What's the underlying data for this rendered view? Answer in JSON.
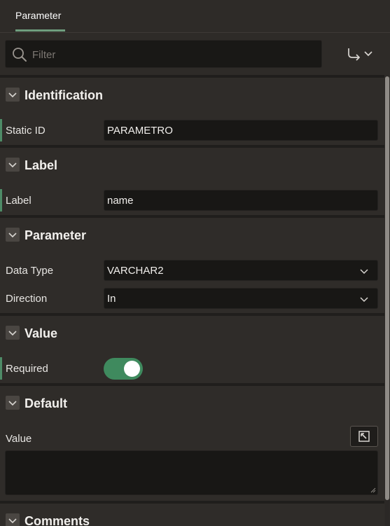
{
  "tabs": [
    {
      "label": "Parameter"
    }
  ],
  "toolbar": {
    "filter_placeholder": "Filter",
    "search_icon": "search-icon",
    "goto_icon": "go-to-group-icon"
  },
  "groups": {
    "identification": {
      "title": "Identification",
      "static_id_label": "Static ID",
      "static_id_value": "PARAMETRO"
    },
    "label": {
      "title": "Label",
      "label_label": "Label",
      "label_value": "name"
    },
    "parameter": {
      "title": "Parameter",
      "data_type_label": "Data Type",
      "data_type_value": "VARCHAR2",
      "direction_label": "Direction",
      "direction_value": "In"
    },
    "value": {
      "title": "Value",
      "required_label": "Required",
      "required_on": true
    },
    "default": {
      "title": "Default",
      "value_label": "Value",
      "value_text": ""
    },
    "comments": {
      "title": "Comments"
    }
  },
  "colors": {
    "accent": "#6f9e7e",
    "toggle_on": "#3f8a5e",
    "required_bar": "#4e8b67"
  }
}
